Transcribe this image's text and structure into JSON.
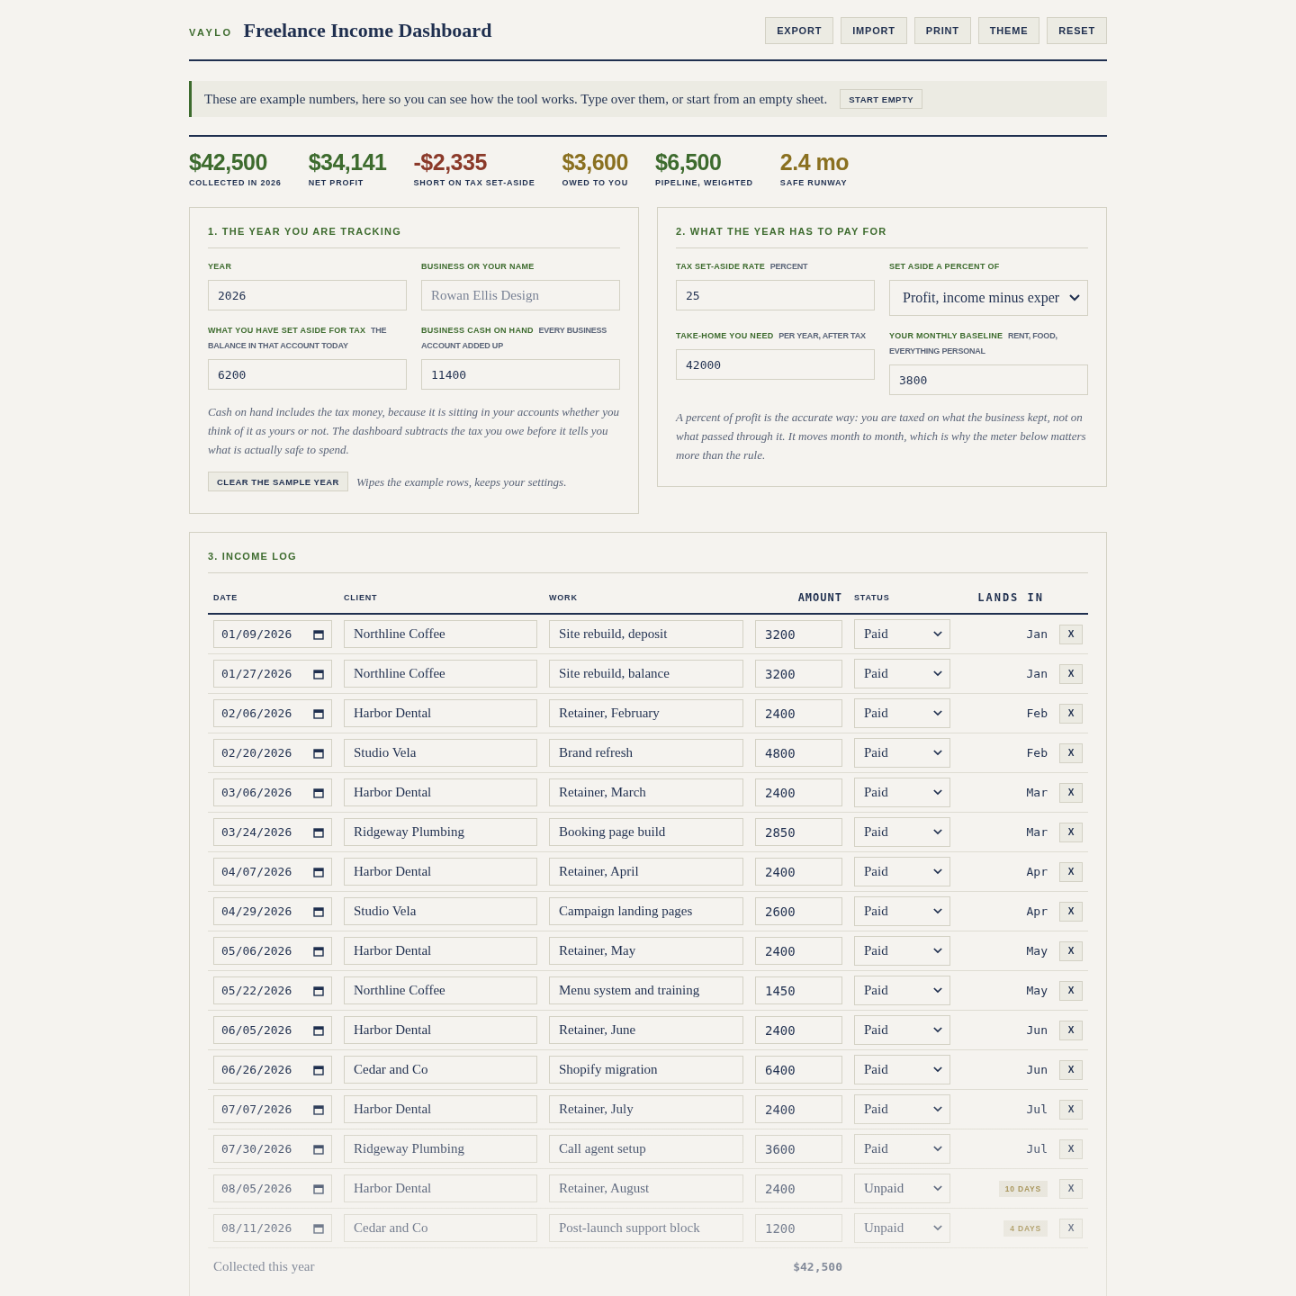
{
  "brand": "VAYLO",
  "title": "Freelance Income Dashboard",
  "actions": [
    "EXPORT",
    "IMPORT",
    "PRINT",
    "THEME",
    "RESET"
  ],
  "notice": {
    "text": "These are example numbers, here so you can see how the tool works. Type over them, or start from an empty sheet.",
    "button": "START EMPTY"
  },
  "kpis": [
    {
      "value": "$42,500",
      "label": "COLLECTED IN 2026",
      "color": "#3d6b2e"
    },
    {
      "value": "$34,141",
      "label": "NET PROFIT",
      "color": "#3d6b2e"
    },
    {
      "value": "-$2,335",
      "label": "SHORT ON TAX SET-ASIDE",
      "color": "#8b3a2a"
    },
    {
      "value": "$3,600",
      "label": "OWED TO YOU",
      "color": "#8a7020"
    },
    {
      "value": "$6,500",
      "label": "PIPELINE, WEIGHTED",
      "color": "#3d6b2e"
    },
    {
      "value": "2.4 mo",
      "label": "SAFE RUNWAY",
      "color": "#8a7020"
    }
  ],
  "panel_year": {
    "heading": "1. THE YEAR YOU ARE TRACKING",
    "fields": [
      {
        "label": "YEAR",
        "value": "2026",
        "kind": "text"
      },
      {
        "label": "BUSINESS OR YOUR NAME",
        "placeholder": "Rowan Ellis Design",
        "kind": "text"
      },
      {
        "label": "WHAT YOU HAVE SET ASIDE FOR TAX",
        "hint": "THE BALANCE IN THAT ACCOUNT TODAY",
        "value": "6200",
        "kind": "text"
      },
      {
        "label": "BUSINESS CASH ON HAND",
        "hint": "EVERY BUSINESS ACCOUNT ADDED UP",
        "value": "11400",
        "kind": "text"
      }
    ],
    "note": "Cash on hand includes the tax money, because it is sitting in your accounts whether you think of it as yours or not. The dashboard subtracts the tax you owe before it tells you what is actually safe to spend.",
    "button": "CLEAR THE SAMPLE YEAR",
    "button_note": "Wipes the example rows, keeps your settings."
  },
  "panel_costs": {
    "heading": "2. WHAT THE YEAR HAS TO PAY FOR",
    "fields": [
      {
        "label": "TAX SET-ASIDE RATE",
        "hint": "PERCENT",
        "value": "25",
        "kind": "text"
      },
      {
        "label": "SET ASIDE A PERCENT OF",
        "value": "Profit, income minus exper",
        "kind": "select"
      },
      {
        "label": "TAKE-HOME YOU NEED",
        "hint": "PER YEAR, AFTER TAX",
        "value": "42000",
        "kind": "text"
      },
      {
        "label": "YOUR MONTHLY BASELINE",
        "hint": "RENT, FOOD, EVERYTHING PERSONAL",
        "value": "3800",
        "kind": "text"
      }
    ],
    "note": "A percent of profit is the accurate way: you are taxed on what the business kept, not on what passed through it. It moves month to month, which is why the meter below matters more than the rule."
  },
  "income_log": {
    "heading": "3. INCOME LOG",
    "columns": [
      "DATE",
      "CLIENT",
      "WORK",
      "AMOUNT",
      "STATUS",
      "LANDS IN"
    ],
    "rows": [
      {
        "date": "01/09/2026",
        "client": "Northline Coffee",
        "work": "Site rebuild, deposit",
        "amount": "3200",
        "status": "Paid",
        "lands_in": "Jan",
        "kind": "month",
        "remove": "X"
      },
      {
        "date": "01/27/2026",
        "client": "Northline Coffee",
        "work": "Site rebuild, balance",
        "amount": "3200",
        "status": "Paid",
        "lands_in": "Jan",
        "kind": "month",
        "remove": "X"
      },
      {
        "date": "02/06/2026",
        "client": "Harbor Dental",
        "work": "Retainer, February",
        "amount": "2400",
        "status": "Paid",
        "lands_in": "Feb",
        "kind": "month",
        "remove": "X"
      },
      {
        "date": "02/20/2026",
        "client": "Studio Vela",
        "work": "Brand refresh",
        "amount": "4800",
        "status": "Paid",
        "lands_in": "Feb",
        "kind": "month",
        "remove": "X"
      },
      {
        "date": "03/06/2026",
        "client": "Harbor Dental",
        "work": "Retainer, March",
        "amount": "2400",
        "status": "Paid",
        "lands_in": "Mar",
        "kind": "month",
        "remove": "X"
      },
      {
        "date": "03/24/2026",
        "client": "Ridgeway Plumbing",
        "work": "Booking page build",
        "amount": "2850",
        "status": "Paid",
        "lands_in": "Mar",
        "kind": "month",
        "remove": "X"
      },
      {
        "date": "04/07/2026",
        "client": "Harbor Dental",
        "work": "Retainer, April",
        "amount": "2400",
        "status": "Paid",
        "lands_in": "Apr",
        "kind": "month",
        "remove": "X"
      },
      {
        "date": "04/29/2026",
        "client": "Studio Vela",
        "work": "Campaign landing pages",
        "amount": "2600",
        "status": "Paid",
        "lands_in": "Apr",
        "kind": "month",
        "remove": "X"
      },
      {
        "date": "05/06/2026",
        "client": "Harbor Dental",
        "work": "Retainer, May",
        "amount": "2400",
        "status": "Paid",
        "lands_in": "May",
        "kind": "month",
        "remove": "X"
      },
      {
        "date": "05/22/2026",
        "client": "Northline Coffee",
        "work": "Menu system and training",
        "amount": "1450",
        "status": "Paid",
        "lands_in": "May",
        "kind": "month",
        "remove": "X"
      },
      {
        "date": "06/05/2026",
        "client": "Harbor Dental",
        "work": "Retainer, June",
        "amount": "2400",
        "status": "Paid",
        "lands_in": "Jun",
        "kind": "month",
        "remove": "X"
      },
      {
        "date": "06/26/2026",
        "client": "Cedar and Co",
        "work": "Shopify migration",
        "amount": "6400",
        "status": "Paid",
        "lands_in": "Jun",
        "kind": "month",
        "remove": "X"
      },
      {
        "date": "07/07/2026",
        "client": "Harbor Dental",
        "work": "Retainer, July",
        "amount": "2400",
        "status": "Paid",
        "lands_in": "Jul",
        "kind": "month",
        "remove": "X"
      },
      {
        "date": "07/30/2026",
        "client": "Ridgeway Plumbing",
        "work": "Call agent setup",
        "amount": "3600",
        "status": "Paid",
        "lands_in": "Jul",
        "kind": "month",
        "remove": "X"
      },
      {
        "date": "08/05/2026",
        "client": "Harbor Dental",
        "work": "Retainer, August",
        "amount": "2400",
        "status": "Unpaid",
        "lands_in": "10 DAYS",
        "kind": "due",
        "remove": "X"
      },
      {
        "date": "08/11/2026",
        "client": "Cedar and Co",
        "work": "Post-launch support block",
        "amount": "1200",
        "status": "Unpaid",
        "lands_in": "4 DAYS",
        "kind": "due",
        "remove": "X"
      }
    ],
    "total": {
      "label": "Collected this year",
      "value": "$42,500"
    }
  }
}
